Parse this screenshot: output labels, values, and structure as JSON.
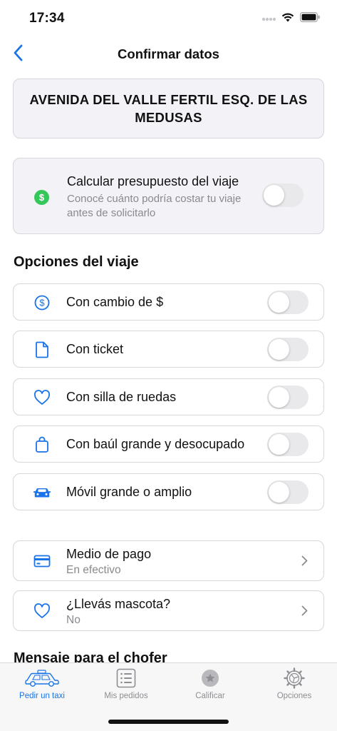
{
  "status": {
    "time": "17:34"
  },
  "nav": {
    "title": "Confirmar datos"
  },
  "address": {
    "text": "AVENIDA DEL VALLE FERTIL ESQ. DE LAS MEDUSAS"
  },
  "budget": {
    "title": "Calcular presupuesto del viaje",
    "subtitle": "Conocé cuánto podría costar tu viaje antes de solicitarlo",
    "icon": "dollar-circle-icon",
    "enabled": false
  },
  "options": {
    "title": "Opciones del viaje",
    "items": [
      {
        "label": "Con cambio de $",
        "icon": "dollar-icon",
        "enabled": false
      },
      {
        "label": "Con ticket",
        "icon": "document-icon",
        "enabled": false
      },
      {
        "label": "Con silla de ruedas",
        "icon": "heart-icon",
        "enabled": false
      },
      {
        "label": "Con baúl grande y desocupado",
        "icon": "bag-icon",
        "enabled": false
      },
      {
        "label": "Móvil grande o amplio",
        "icon": "car-icon",
        "enabled": false
      }
    ]
  },
  "payment": {
    "label": "Medio de pago",
    "value": "En efectivo",
    "icon": "credit-card-icon"
  },
  "pet": {
    "label": "¿Llevás mascota?",
    "value": "No",
    "icon": "heart-icon"
  },
  "message": {
    "title": "Mensaje para el chofer"
  },
  "tabs": [
    {
      "label": "Pedir un taxi",
      "icon": "taxi-icon",
      "active": true
    },
    {
      "label": "Mis pedidos",
      "icon": "list-icon",
      "active": false
    },
    {
      "label": "Calificar",
      "icon": "star-circle-icon",
      "active": false
    },
    {
      "label": "Opciones",
      "icon": "gear-icon",
      "active": false
    }
  ],
  "colors": {
    "accent": "#1a73e8",
    "green": "#34c759",
    "card_bg": "#f2f2f7",
    "muted": "#8a8a8e"
  }
}
